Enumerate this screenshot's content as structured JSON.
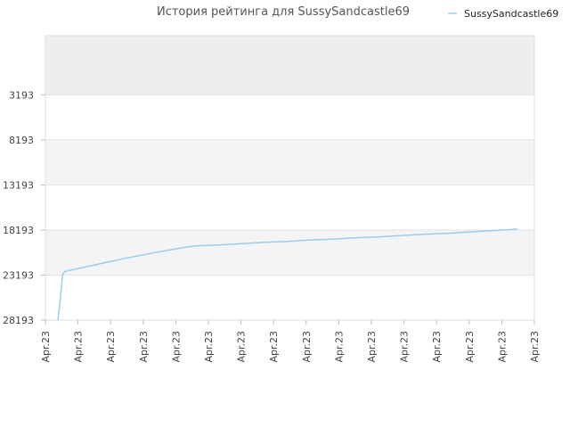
{
  "chart_data": {
    "type": "line",
    "title": "История рейтинга для SussySandcastle69",
    "xlabel": "",
    "ylabel": "",
    "y_axis_inverted": true,
    "ylim": [
      28193,
      0
    ],
    "y_ticks": [
      "3193",
      "8193",
      "13193",
      "18193",
      "23193",
      "28193"
    ],
    "x_ticks": [
      "Apr.23",
      "Apr.23",
      "Apr.23",
      "Apr.23",
      "Apr.23",
      "Apr.23",
      "Apr.23",
      "Apr.23",
      "Apr.23",
      "Apr.23",
      "Apr.23",
      "Apr.23",
      "Apr.23",
      "Apr.23",
      "Apr.23",
      "Apr.23"
    ],
    "legend": {
      "position": "top-right"
    },
    "grid": true,
    "series": [
      {
        "name": "SussySandcastle69",
        "color": "#99ccee",
        "points": [
          [
            0.0,
            28193
          ],
          [
            0.004,
            26400
          ],
          [
            0.007,
            25000
          ],
          [
            0.01,
            23200
          ],
          [
            0.015,
            22800
          ],
          [
            0.05,
            22400
          ],
          [
            0.1,
            21850
          ],
          [
            0.15,
            21300
          ],
          [
            0.2,
            20800
          ],
          [
            0.25,
            20350
          ],
          [
            0.29,
            20000
          ],
          [
            0.3,
            19950
          ],
          [
            0.35,
            19850
          ],
          [
            0.4,
            19700
          ],
          [
            0.45,
            19550
          ],
          [
            0.5,
            19450
          ],
          [
            0.55,
            19300
          ],
          [
            0.6,
            19200
          ],
          [
            0.65,
            19050
          ],
          [
            0.7,
            18950
          ],
          [
            0.75,
            18800
          ],
          [
            0.8,
            18650
          ],
          [
            0.85,
            18550
          ],
          [
            0.9,
            18400
          ],
          [
            0.95,
            18250
          ],
          [
            1.0,
            18100
          ]
        ]
      }
    ]
  }
}
